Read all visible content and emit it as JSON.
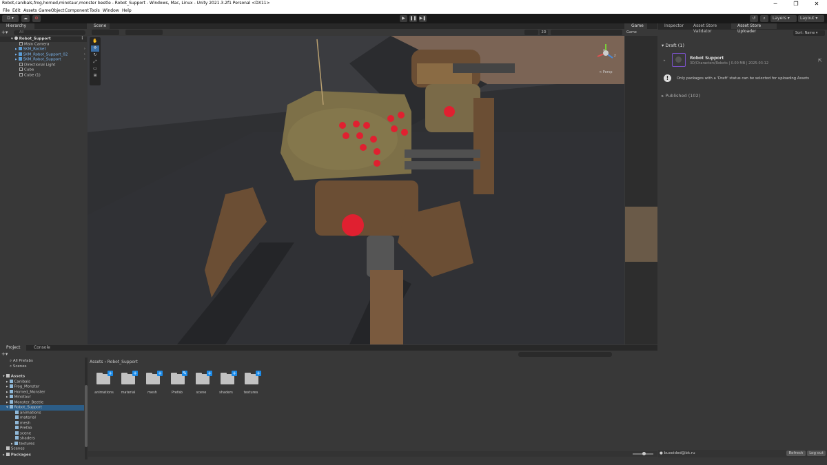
{
  "window": {
    "title": "Robot,canibals,frog,horned,minotaur,monster beetle - Robot_Support - Windows, Mac, Linux - Unity 2021.3.2f1 Personal <DX11>",
    "minimize": "─",
    "maximize": "❐",
    "close": "✕"
  },
  "menu": [
    "File",
    "Edit",
    "Assets",
    "GameObject",
    "Component",
    "Tools",
    "Window",
    "Help"
  ],
  "toolbar": {
    "account": "D ▾",
    "layers": "Layers",
    "layout": "Layout"
  },
  "hierarchy": {
    "tab": "Hierarchy",
    "search_placeholder": "All",
    "scene_name": "Robot_Support",
    "items": [
      {
        "label": "Main Camera",
        "prefab": false
      },
      {
        "label": "SKM_Rocket",
        "prefab": true
      },
      {
        "label": "SKM_Robot_Support_02",
        "prefab": true
      },
      {
        "label": "SKM_Robot_Support",
        "prefab": true
      },
      {
        "label": "Directional Light",
        "prefab": false
      },
      {
        "label": "Cube",
        "prefab": false
      },
      {
        "label": "Cube (1)",
        "prefab": false
      }
    ]
  },
  "scene": {
    "tab": "Scene",
    "persp": "< Persp",
    "view_2d": "2D",
    "gizmo_x": "x",
    "gizmo_z": "z"
  },
  "game": {
    "tab": "Game",
    "display": "Game"
  },
  "inspector": {
    "tabs": [
      "Inspector",
      "Asset Store Validator",
      "Asset Store Uploader"
    ],
    "sort": "Sort: Name ▾",
    "draft_header": "Draft (1)",
    "package_name": "Robot Support",
    "package_meta": "3D/Characters/Robots | 0.00 MB | 2025-03-12",
    "notice": "Only packages with a 'Draft' status can be selected for uploading Assets",
    "published_header": "Published (102)",
    "account_email": "buxoided@bk.ru",
    "refresh": "Refresh",
    "logout": "Log out"
  },
  "project": {
    "tabs": [
      "Project",
      "Console"
    ],
    "favorites": [
      "All Prefabs",
      "Scenes"
    ],
    "root": "Assets",
    "tree": [
      "Canibals",
      "Frog_Monster",
      "Horned_Monster",
      "Minotaur",
      "Monster_Beetle",
      "Robot_Support"
    ],
    "robot_children": [
      "animations",
      "material",
      "mesh",
      "Prefab",
      "scene",
      "shaders",
      "textures"
    ],
    "scenes": "Scenes",
    "packages": "Packages",
    "breadcrumb": [
      "Assets",
      "Robot_Support"
    ],
    "folders": [
      "animations",
      "material",
      "mesh",
      "Prefab",
      "scene",
      "shaders",
      "textures"
    ]
  },
  "colors": {
    "accent_blue": "#1a8ae8",
    "selection": "#2c5d87",
    "prefab_text": "#7cb6f0",
    "panel_bg": "#383838",
    "toolbar_bg": "#191919",
    "draft_icon": "#7a52c8"
  },
  "icons": {
    "unity_logo": "unity-logo-icon",
    "play": "play-icon",
    "pause": "pause-icon",
    "step": "step-icon",
    "notice": "exclamation-icon"
  }
}
